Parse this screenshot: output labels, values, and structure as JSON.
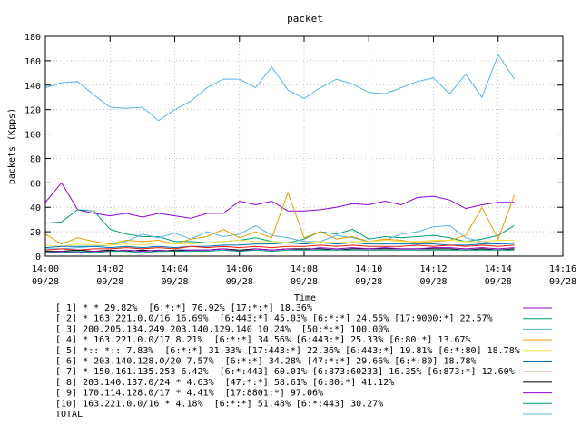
{
  "chart_data": {
    "type": "line",
    "title": "packet",
    "xlabel": "Time",
    "ylabel": "packets (Kpps)",
    "ylim": [
      0,
      180
    ],
    "yticks": [
      0,
      20,
      40,
      60,
      80,
      100,
      120,
      140,
      160,
      180
    ],
    "xlim": [
      "14:00",
      "14:16"
    ],
    "xticks": [
      {
        "time": "14:00",
        "date": "09/28"
      },
      {
        "time": "14:02",
        "date": "09/28"
      },
      {
        "time": "14:04",
        "date": "09/28"
      },
      {
        "time": "14:06",
        "date": "09/28"
      },
      {
        "time": "14:08",
        "date": "09/28"
      },
      {
        "time": "14:10",
        "date": "09/28"
      },
      {
        "time": "14:12",
        "date": "09/28"
      },
      {
        "time": "14:14",
        "date": "09/28"
      },
      {
        "time": "14:16",
        "date": "09/28"
      }
    ],
    "grid": true,
    "legend_position": "bottom",
    "x": [
      "14:00:00",
      "14:00:30",
      "14:01:00",
      "14:01:30",
      "14:02:00",
      "14:02:30",
      "14:03:00",
      "14:03:30",
      "14:04:00",
      "14:04:30",
      "14:05:00",
      "14:05:30",
      "14:06:00",
      "14:06:30",
      "14:07:00",
      "14:07:30",
      "14:08:00",
      "14:08:30",
      "14:09:00",
      "14:09:30",
      "14:10:00",
      "14:10:30",
      "14:11:00",
      "14:11:30",
      "14:12:00",
      "14:12:30",
      "14:13:00",
      "14:13:30",
      "14:14:00",
      "14:14:30"
    ],
    "series": [
      {
        "name": "[ 1] * * 29.82%  [6:*:*] 76.92% [17:*:*] 18.36%",
        "color": "#9400d3",
        "values": [
          44,
          60,
          38,
          35,
          33,
          35,
          32,
          35,
          33,
          31,
          35,
          35,
          45,
          42,
          45,
          37,
          37,
          38,
          40,
          43,
          42,
          45,
          42,
          48,
          49,
          46,
          39,
          42,
          44,
          44
        ]
      },
      {
        "name": "[ 2] * 163.221.0.0/16 16.69%  [6:443:*] 45.03% [6:*:*] 24.55% [17:9000:*] 22.57%",
        "color": "#009e73",
        "values": [
          27,
          28,
          38,
          37,
          22,
          18,
          16,
          16,
          12,
          12,
          11,
          12,
          13,
          15,
          12,
          11,
          14,
          20,
          18,
          22,
          14,
          16,
          15,
          16,
          17,
          15,
          12,
          14,
          17,
          25
        ]
      },
      {
        "name": "[ 3] 200.205.134.249 203.140.129.140 10.24%  [50:*:*] 100.00%",
        "color": "#56b4e9",
        "values": [
          6,
          6,
          7,
          8,
          9,
          12,
          18,
          15,
          19,
          14,
          20,
          16,
          18,
          25,
          17,
          15,
          12,
          12,
          17,
          15,
          12,
          13,
          18,
          20,
          24,
          25,
          15,
          12,
          10,
          10
        ]
      },
      {
        "name": "[ 4] * 163.221.0.0/17 8.21%  [6:*:*] 34.56% [6:443:*] 25.33% [6:80:*] 13.67%",
        "color": "#e69f00",
        "values": [
          18,
          10,
          15,
          12,
          10,
          13,
          12,
          13,
          10,
          14,
          16,
          22,
          15,
          20,
          15,
          52,
          15,
          20,
          14,
          16,
          12,
          14,
          13,
          11,
          12,
          13,
          17,
          40,
          14,
          50
        ]
      },
      {
        "name": "[ 5] *:: *:: 7.83%  [6:*:*] 31.33% [17:443:*] 22.36% [6:443:*] 19.81% [6:*:80] 18.78%",
        "color": "#f0e442",
        "values": [
          9,
          8,
          10,
          9,
          9,
          10,
          9,
          11,
          10,
          10,
          11,
          12,
          13,
          12,
          12,
          11,
          11,
          12,
          11,
          12,
          12,
          13,
          12,
          12,
          13,
          13,
          12,
          12,
          13,
          13
        ]
      },
      {
        "name": "[ 6] * 203.140.128.0/20 7.57%  [6:*:*] 34.28% [47:*:*] 29.66% [6:*:80] 18.78%",
        "color": "#0072b2",
        "values": [
          7,
          8,
          8,
          8,
          7,
          8,
          7,
          8,
          7,
          8,
          8,
          9,
          9,
          10,
          10,
          11,
          10,
          11,
          10,
          11,
          10,
          10,
          10,
          10,
          10,
          9,
          9,
          10,
          10,
          11
        ]
      },
      {
        "name": "[ 7] * 150.161.135.253 6.42%  [6:*:443] 60.01% [6:873:60233] 16.35% [6:873:*] 12.60%",
        "color": "#e51e10",
        "values": [
          5,
          6,
          5,
          6,
          6,
          7,
          6,
          7,
          6,
          8,
          7,
          8,
          7,
          8,
          7,
          8,
          8,
          9,
          8,
          9,
          8,
          8,
          8,
          9,
          8,
          9,
          8,
          9,
          8,
          9
        ]
      },
      {
        "name": "[ 8] 203.140.137.0/24 * 4.63%  [47:*:*] 58.61% [6:80:*] 41.12%",
        "color": "#000000",
        "values": [
          4,
          4,
          5,
          4,
          5,
          4,
          5,
          4,
          5,
          5,
          5,
          6,
          5,
          6,
          5,
          6,
          6,
          6,
          5,
          6,
          6,
          6,
          6,
          6,
          6,
          6,
          5,
          6,
          5,
          6
        ]
      },
      {
        "name": "[ 9] 170.114.128.0/17 * 4.41%  [17:8801:*] 97.06%",
        "color": "#9400d3",
        "values": [
          3,
          4,
          3,
          4,
          4,
          5,
          4,
          5,
          4,
          5,
          5,
          6,
          4,
          6,
          5,
          6,
          5,
          7,
          6,
          7,
          6,
          7,
          6,
          6,
          7,
          7,
          6,
          7,
          6,
          7
        ]
      },
      {
        "name": "[10] 163.221.0.0/16 * 4.18%  [6:*:*] 51.48% [6:*:443] 30.27%",
        "color": "#009e73",
        "values": [
          3,
          3,
          4,
          3,
          4,
          4,
          3,
          4,
          4,
          4,
          4,
          5,
          4,
          5,
          4,
          5,
          5,
          5,
          5,
          5,
          5,
          5,
          5,
          5,
          5,
          5,
          5,
          5,
          5,
          5
        ]
      },
      {
        "name": "TOTAL",
        "color": "#56b4e9",
        "values": [
          138,
          142,
          143,
          132,
          122,
          121,
          122,
          111,
          120,
          127,
          138,
          145,
          145,
          138,
          155,
          136,
          129,
          138,
          145,
          141,
          134,
          133,
          138,
          143,
          146,
          133,
          149,
          130,
          165,
          145
        ]
      }
    ]
  }
}
